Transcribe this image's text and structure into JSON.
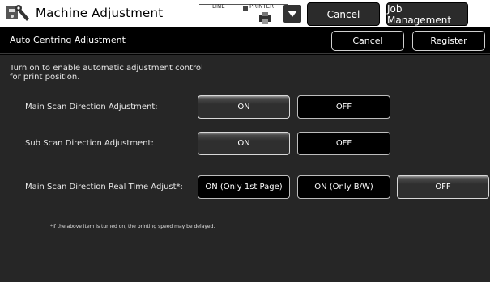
{
  "header": {
    "title": "Machine Adjustment",
    "line_label": "LINE",
    "printer_label": "PRINTER",
    "cancel_label": "Cancel",
    "job_management_label": "Job Management",
    "app_icon": "wrench-settings-icon",
    "printer_icon": "printer-icon",
    "dropdown_icon": "triangle-down-icon"
  },
  "subheader": {
    "title": "Auto Centring Adjustment",
    "cancel_label": "Cancel",
    "register_label": "Register"
  },
  "main": {
    "description_line1": "Turn on to enable automatic adjustment control",
    "description_line2": "for print position.",
    "rows": [
      {
        "label": "Main Scan Direction Adjustment:",
        "options": [
          "ON",
          "OFF"
        ],
        "selected": "ON"
      },
      {
        "label": "Sub Scan Direction Adjustment:",
        "options": [
          "ON",
          "OFF"
        ],
        "selected": "ON"
      },
      {
        "label": "Main Scan Direction Real Time Adjust*:",
        "options": [
          "ON (Only 1st Page)",
          "ON (Only B/W)",
          "OFF"
        ],
        "selected": "OFF"
      }
    ],
    "note": "*If the above item is turned on, the printing speed may be delayed."
  },
  "colors": {
    "header_bg": "#ffffff",
    "content_bg": "#262626",
    "selected_button": "#2f2f2f",
    "unselected_button": "#000000"
  }
}
